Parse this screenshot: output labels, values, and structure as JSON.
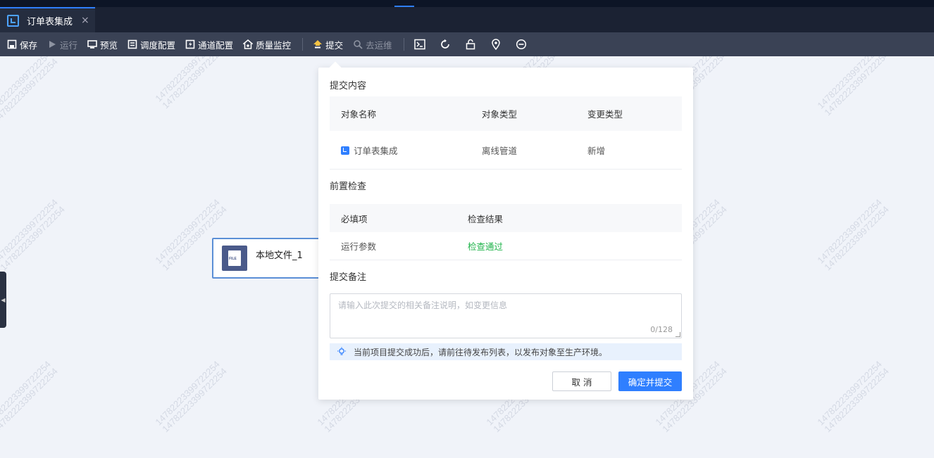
{
  "tab": {
    "title": "订单表集成",
    "close": "×"
  },
  "toolbar": {
    "items": [
      {
        "label": "保存",
        "icon": "save-icon"
      },
      {
        "label": "运行",
        "icon": "run-icon",
        "disabled": true
      },
      {
        "label": "预览",
        "icon": "preview-icon"
      },
      {
        "label": "调度配置",
        "icon": "schedule-config-icon"
      },
      {
        "label": "通道配置",
        "icon": "channel-config-icon"
      },
      {
        "label": "质量监控",
        "icon": "quality-monitor-icon"
      },
      {
        "label": "提交",
        "icon": "submit-icon"
      },
      {
        "label": "去运维",
        "icon": "ops-icon",
        "disabled": true
      }
    ],
    "icon_buttons": [
      "terminal-icon",
      "refresh-icon",
      "lock-icon",
      "location-pin-icon",
      "minus-circle-icon"
    ]
  },
  "canvas": {
    "node": {
      "label": "本地文件_1",
      "icon_text": "FILE"
    },
    "watermark": "14782223399722254"
  },
  "dialog": {
    "content_title": "提交内容",
    "content_headers": [
      "对象名称",
      "对象类型",
      "变更类型"
    ],
    "content_row": {
      "name": "订单表集成",
      "type": "离线管道",
      "change": "新增"
    },
    "precheck_title": "前置检查",
    "precheck_headers": [
      "必填项",
      "检查结果"
    ],
    "precheck_row": {
      "item": "运行参数",
      "result": "检查通过"
    },
    "remark_title": "提交备注",
    "remark_placeholder": "请输入此次提交的相关备注说明，如变更信息",
    "remark_counter": "0/128",
    "tip": "当前项目提交成功后，请前往待发布列表，以发布对象至生产环境。",
    "cancel_label": "取 消",
    "ok_label": "确定并提交"
  },
  "colors": {
    "accent": "#2f7fff",
    "pass": "#1fb34a",
    "toolbar": "#3a4255",
    "tabbar": "#1b2233"
  }
}
